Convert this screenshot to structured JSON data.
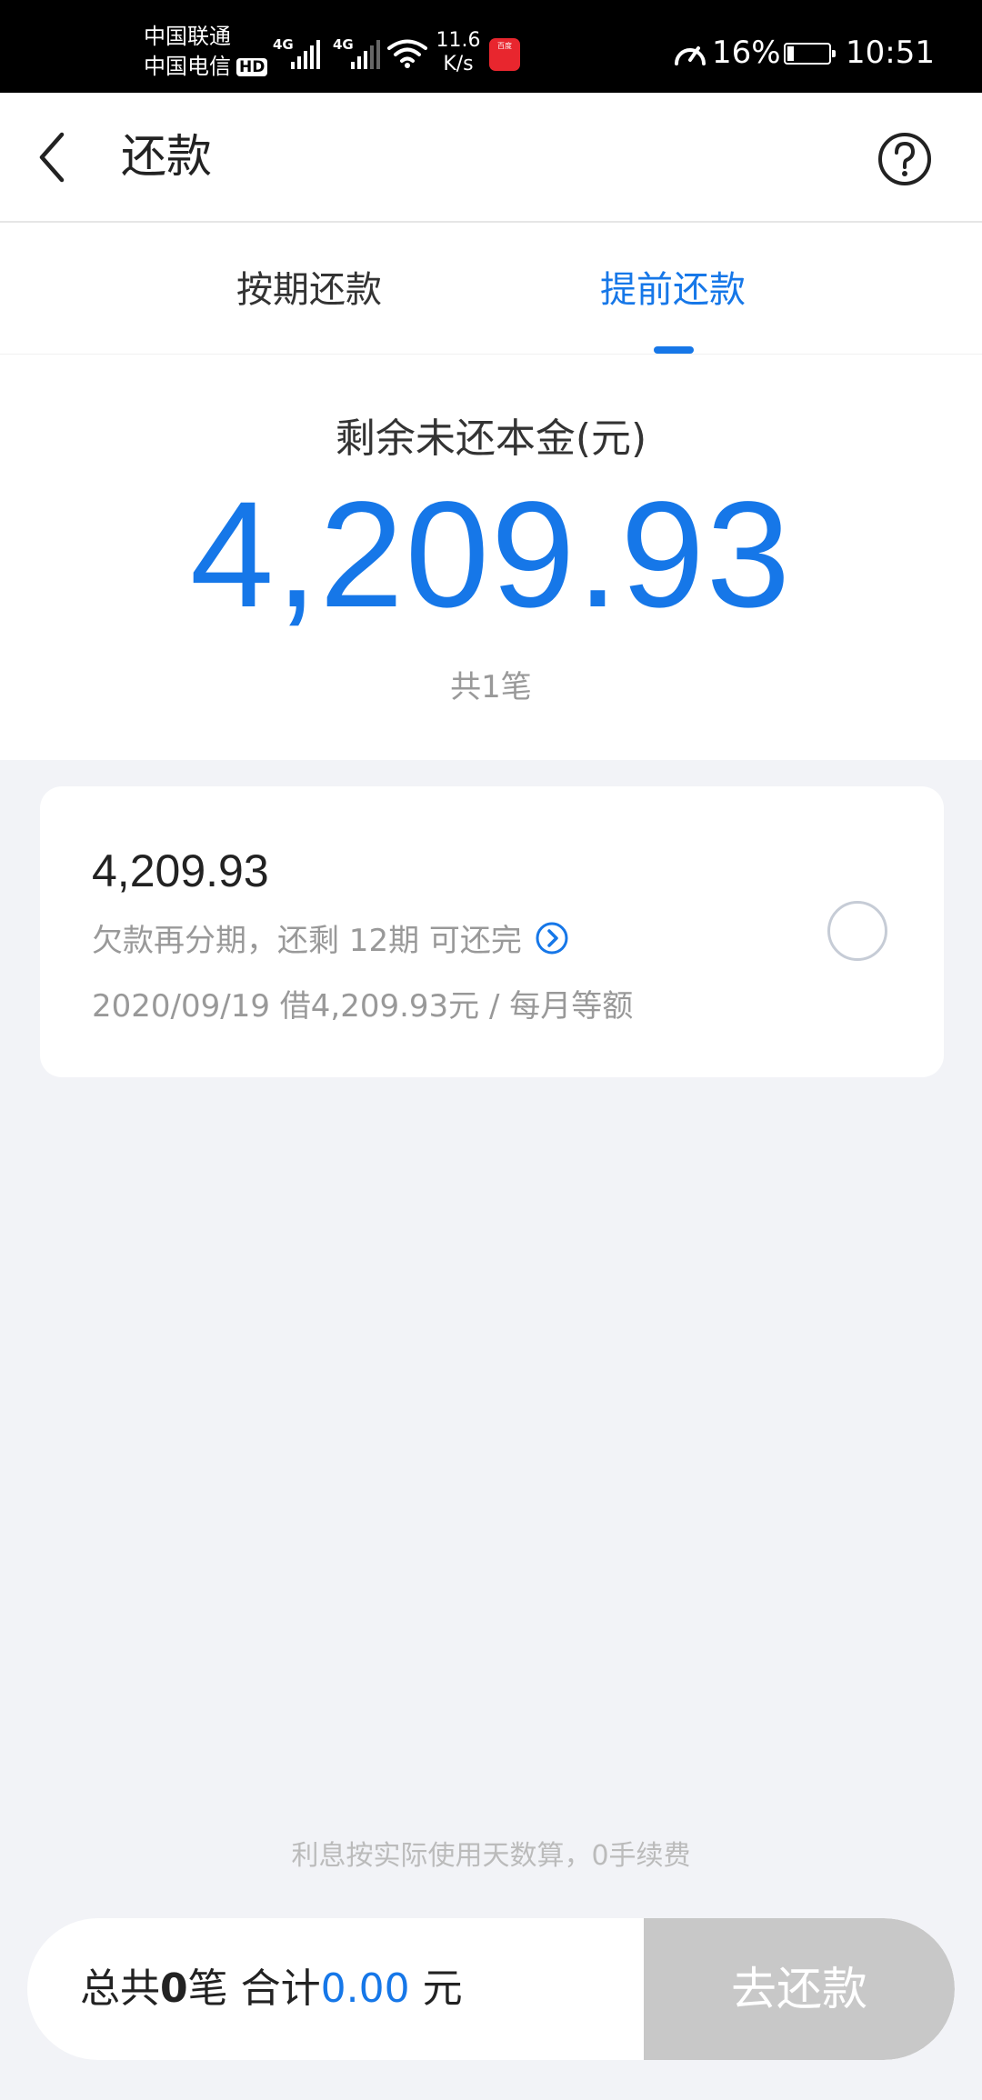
{
  "status_bar": {
    "carrier_1": "中国联通",
    "carrier_2": "中国电信",
    "hd_badge": "HD",
    "network_1": "4G",
    "network_2": "4G",
    "speed_value": "11.6",
    "speed_unit": "K/s",
    "app_notification": "百度",
    "battery_percent": "16%",
    "battery_level": 0.16,
    "time": "10:51"
  },
  "header": {
    "title": "还款",
    "back_icon": "chevron-left-icon",
    "help_icon": "question-circle-icon"
  },
  "tabs": [
    {
      "label": "按期还款",
      "active": false
    },
    {
      "label": "提前还款",
      "active": true
    }
  ],
  "summary": {
    "label": "剩余未还本金(元)",
    "amount": "4,209.93",
    "count": "共1笔"
  },
  "loan": {
    "amount": "4,209.93",
    "plan": "欠款再分期，还剩 12期 可还完",
    "detail": "2020/09/19 借4,209.93元 / 每月等额",
    "selected": false
  },
  "footer": {
    "note": "利息按实际使用天数算，0手续费",
    "total_prefix": "总共",
    "total_count": "0",
    "total_count_unit": "笔 合计",
    "total_amount": "0.00",
    "total_unit": " 元",
    "pay_button": "去还款"
  },
  "colors": {
    "accent": "#1677e8",
    "disabled_button": "#c8c8c8",
    "page_background": "#f2f3f7"
  }
}
